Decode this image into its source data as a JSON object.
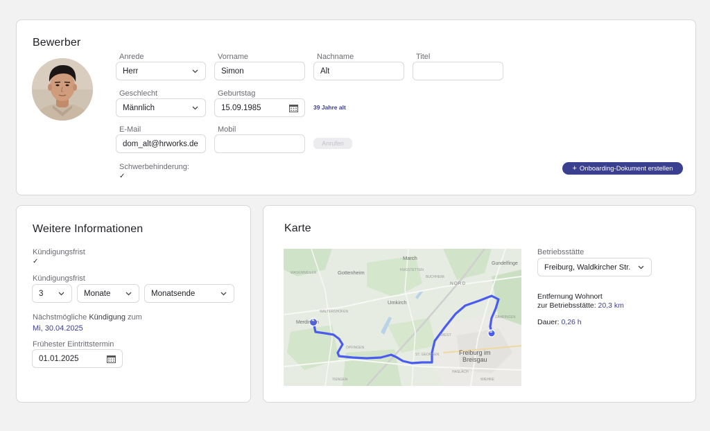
{
  "applicant": {
    "title": "Bewerber",
    "salutation": {
      "label": "Anrede",
      "value": "Herr"
    },
    "first_name": {
      "label": "Vorname",
      "value": "Simon"
    },
    "last_name": {
      "label": "Nachname",
      "value": "Alt"
    },
    "academic_title": {
      "label": "Titel",
      "value": ""
    },
    "gender": {
      "label": "Geschlecht",
      "value": "Männlich"
    },
    "birthday": {
      "label": "Geburtstag",
      "value": "15.09.1985"
    },
    "age_text": "39 Jahre alt",
    "email": {
      "label": "E-Mail",
      "value": "dom_alt@hrworks.de"
    },
    "mobile": {
      "label": "Mobil",
      "value": ""
    },
    "call_button": "Anrufen",
    "disability": {
      "label": "Schwerbehinderung:",
      "checked": true
    },
    "onboarding_button": "Onboarding-Dokument erstellen"
  },
  "more_info": {
    "title": "Weitere Informationen",
    "notice_check": {
      "label": "Kündigungsfrist",
      "checked": true
    },
    "notice_period": {
      "label": "Kündigungsfrist",
      "amount": "3",
      "unit": "Monate",
      "end": "Monatsende"
    },
    "next_termination": {
      "label_prefix": "Nächstmögliche",
      "label_bold": "Kündigung",
      "label_suffix": "zum",
      "value": "Mi, 30.04.2025"
    },
    "earliest_start": {
      "label": "Frühester Eintrittstermin",
      "value": "01.01.2025"
    }
  },
  "map_card": {
    "title": "Karte",
    "site": {
      "label": "Betriebsstätte",
      "value": "Freiburg, Waldkircher Str."
    },
    "distance": {
      "line1": "Entfernung Wohnort",
      "line2": "zur Betriebsstätte:",
      "value": "20,3 km"
    },
    "duration": {
      "label": "Dauer:",
      "value": "0,26 h"
    },
    "map_labels": {
      "gottenheim": "Gottenheim",
      "march": "March",
      "umkirch": "Umkirch",
      "nord": "NORD",
      "merdingen": "Merdingen",
      "freiburg": "Freiburg im\nBreisgau",
      "gundelfingen": "Gundelfinge",
      "waltershofen": "WALTERSHOFEN",
      "opfingen": "OPFINGEN",
      "west": "WEST",
      "zaehringen": "ZÄHRINGEN",
      "hugstetten": "HUGSTETTEN",
      "buchheim": "BUCHHEIM",
      "wasenweiler": "WASENWEILER",
      "haslach": "HASLACH",
      "wiehre": "WIEHRE",
      "tiengen": "TIENGEN",
      "st_georgen": "ST. GEORGEN",
      "marker_a": "A",
      "marker_b": "B"
    },
    "route_color": "#4a5cf0"
  },
  "colors": {
    "accent": "#3b3f8f",
    "route": "#4a5cf0"
  }
}
